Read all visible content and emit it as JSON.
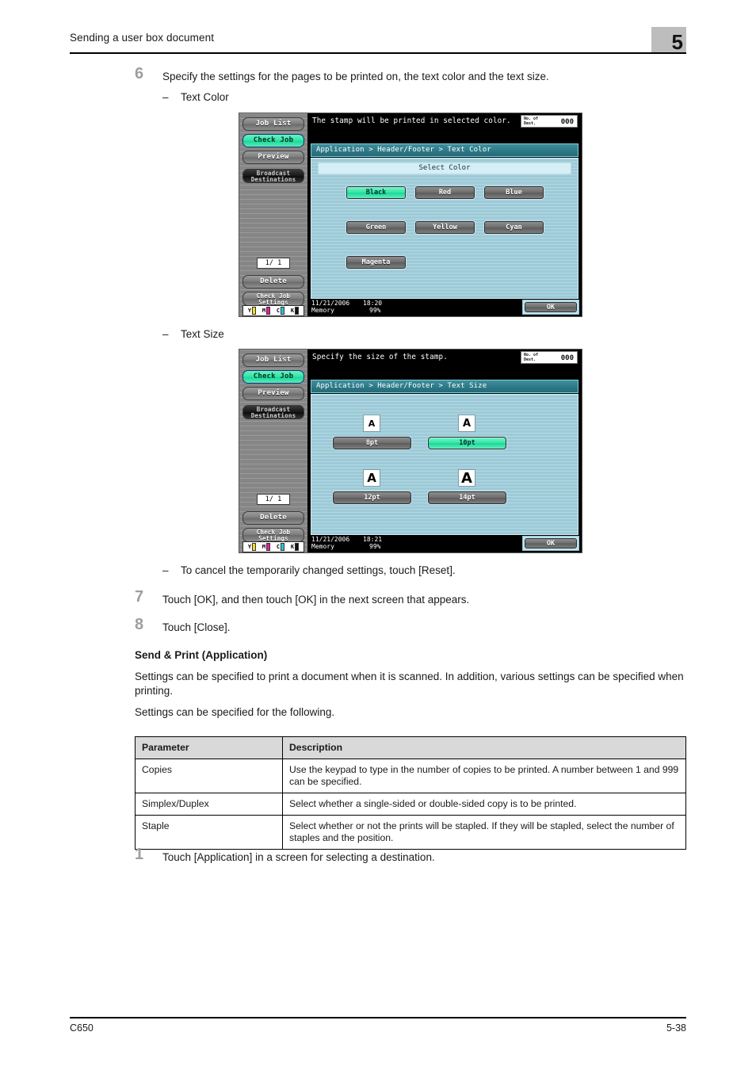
{
  "header": {
    "title": "Sending a user box document",
    "chapter": "5"
  },
  "footer": {
    "model": "C650",
    "page": "5-38"
  },
  "steps": {
    "step6_num": "6",
    "step6_text": "Specify the settings for the pages to be printed on, the text color and the text size.",
    "dash_text_color": "Text Color",
    "dash_text_size": "Text Size",
    "dash_reset": "To cancel the temporarily changed settings, touch [Reset].",
    "dash_bullet": "–",
    "step7_num": "7",
    "step7_text": "Touch [OK], and then touch [OK] in the next screen that appears.",
    "step8_num": "8",
    "step8_text": "Touch [Close].",
    "step1_num": "1",
    "step1_text": "Touch [Application] in a screen for selecting a destination."
  },
  "section": {
    "subhead": "Send & Print (Application)",
    "para1": "Settings can be specified to print a document when it is scanned. In addition, various settings can be specified when printing.",
    "para2": "Settings can be specified for the following."
  },
  "table": {
    "headers": [
      "Parameter",
      "Description"
    ],
    "rows": [
      {
        "parameter": "Copies",
        "description": "Use the keypad to type in the number of copies to be printed. A number between 1 and 999 can be specified."
      },
      {
        "parameter": "Simplex/Duplex",
        "description": "Select whether a single-sided or double-sided copy is to be printed."
      },
      {
        "parameter": "Staple",
        "description": "Select whether or not the prints will be stapled. If they will be stapled, select the number of staples and the position."
      }
    ]
  },
  "lcd_common": {
    "sidebar": {
      "job_list": "Job List",
      "check_job": "Check Job",
      "preview": "Preview",
      "broadcast_line1": "Broadcast",
      "broadcast_line2": "Destinations",
      "page_indicator": "1/  1",
      "delete": "Delete",
      "check_job_settings_line1": "Check Job",
      "check_job_settings_line2": "Settings"
    },
    "toner": {
      "y_label": "Y",
      "m_label": "M",
      "c_label": "C",
      "k_label": "K",
      "y_color": "#f2e11a",
      "m_color": "#ea1ba0",
      "c_color": "#23c8dd",
      "k_color": "#111111"
    },
    "dest_counter": {
      "label_line1": "No. of",
      "label_line2": "Dest.",
      "count": "000"
    },
    "ok_label": "OK",
    "memory_label": "Memory"
  },
  "lcd_text_color": {
    "message": "The stamp will be printed in selected color.",
    "breadcrumb": "Application > Header/Footer > Text Color",
    "section_title": "Select Color",
    "buttons": [
      {
        "label": "Black",
        "selected": true
      },
      {
        "label": "Red",
        "selected": false
      },
      {
        "label": "Blue",
        "selected": false
      },
      {
        "label": "Green",
        "selected": false
      },
      {
        "label": "Yellow",
        "selected": false
      },
      {
        "label": "Cyan",
        "selected": false
      },
      {
        "label": "Magenta",
        "selected": false
      }
    ],
    "date": "11/21/2006",
    "time": "18:20",
    "memory_pct": "99%"
  },
  "lcd_text_size": {
    "message": "Specify the size of the stamp.",
    "breadcrumb": "Application > Header/Footer > Text Size",
    "buttons": [
      {
        "label": "8pt",
        "glyph": "A",
        "selected": false
      },
      {
        "label": "10pt",
        "glyph": "A",
        "selected": true
      },
      {
        "label": "12pt",
        "glyph": "A",
        "selected": false
      },
      {
        "label": "14pt",
        "glyph": "A",
        "selected": false
      }
    ],
    "date": "11/21/2006",
    "time": "18:21",
    "memory_pct": "99%"
  }
}
